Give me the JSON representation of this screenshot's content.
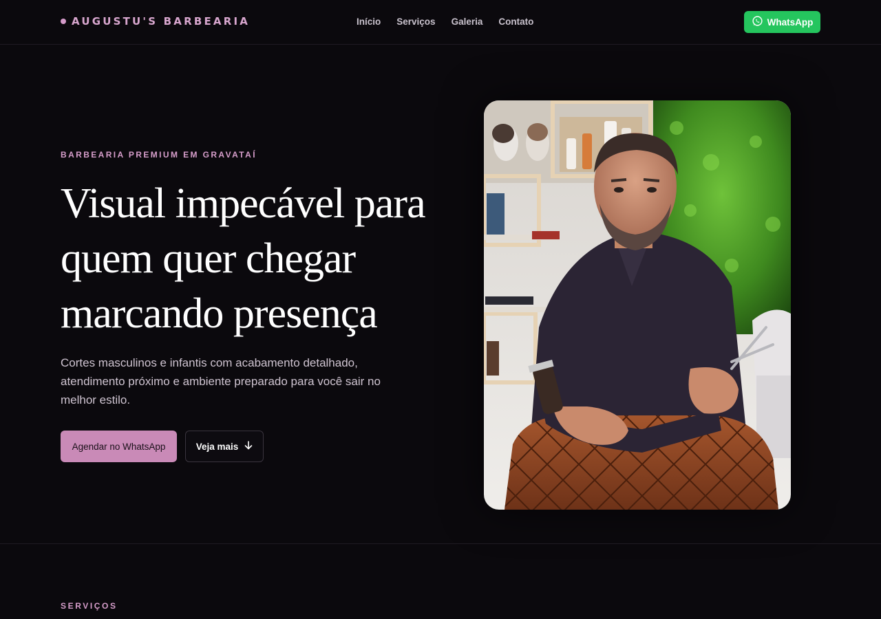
{
  "header": {
    "brand": "AUGUSTU'S BARBEARIA",
    "nav": [
      "Início",
      "Serviços",
      "Galeria",
      "Contato"
    ],
    "whatsapp_label": "WhatsApp"
  },
  "hero": {
    "eyebrow": "BARBEARIA PREMIUM EM GRAVATAÍ",
    "headline": "Visual impecável para quem quer chegar marcando presença",
    "lead": "Cortes masculinos e infantis com acabamento detalhado, atendimento próximo e ambiente preparado para você sair no melhor estilo.",
    "cta_primary": "Agendar no WhatsApp",
    "cta_secondary": "Veja mais"
  },
  "services": {
    "label": "SERVIÇOS"
  },
  "colors": {
    "background": "#0b090d",
    "accent": "#c98ab7",
    "whatsapp": "#25c55e"
  },
  "icons": {
    "whatsapp": "whatsapp-icon",
    "arrow": "arrow-down-icon"
  }
}
